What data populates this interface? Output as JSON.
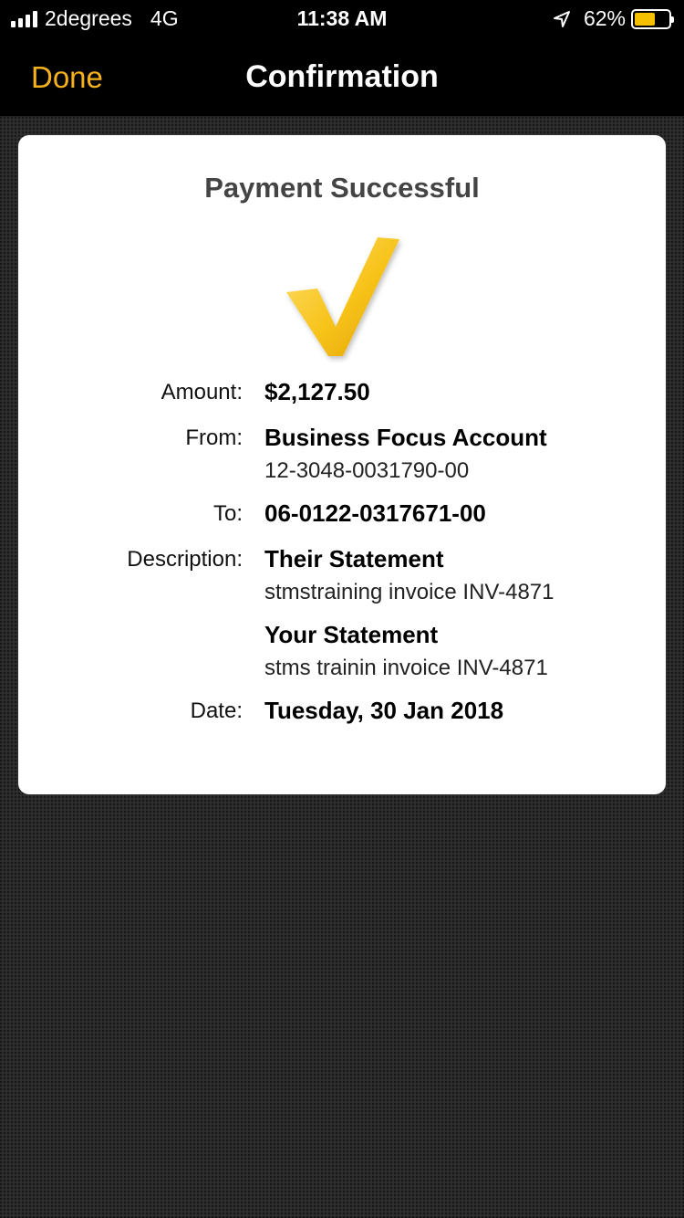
{
  "status": {
    "carrier": "2degrees",
    "network": "4G",
    "time": "11:38 AM",
    "battery": "62%",
    "battery_level": 0.62,
    "battery_color": "#f5c000"
  },
  "nav": {
    "done_label": "Done",
    "title": "Confirmation",
    "accent_color": "#f5b21c"
  },
  "card": {
    "title": "Payment Successful",
    "icon": "checkmark-icon",
    "amount_label": "Amount:",
    "amount": "$2,127.50",
    "from_label": "From:",
    "from_name": "Business Focus Account",
    "from_number": "12-3048-0031790-00",
    "to_label": "To:",
    "to_number": "06-0122-0317671-00",
    "description_label": "Description:",
    "their_statement_title": "Their Statement",
    "their_statement": "stmstraining invoice INV-4871",
    "your_statement_title": "Your Statement",
    "your_statement": "stms trainin invoice INV-4871",
    "date_label": "Date:",
    "date": "Tuesday, 30 Jan 2018"
  }
}
